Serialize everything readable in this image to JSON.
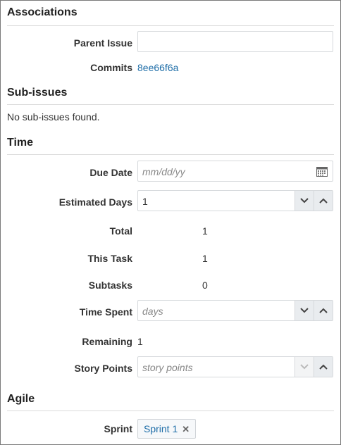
{
  "associations": {
    "title": "Associations",
    "parent_issue_label": "Parent Issue",
    "parent_issue_value": "",
    "commits_label": "Commits",
    "commits_value": "8ee66f6a"
  },
  "sub_issues": {
    "title": "Sub-issues",
    "empty_text": "No sub-issues found."
  },
  "time": {
    "title": "Time",
    "due_date_label": "Due Date",
    "due_date_placeholder": "mm/dd/yy",
    "estimated_days_label": "Estimated Days",
    "estimated_days_value": "1",
    "total_label": "Total",
    "total_value": "1",
    "this_task_label": "This Task",
    "this_task_value": "1",
    "subtasks_label": "Subtasks",
    "subtasks_value": "0",
    "time_spent_label": "Time Spent",
    "time_spent_placeholder": "days",
    "remaining_label": "Remaining",
    "remaining_value": "1",
    "story_points_label": "Story Points",
    "story_points_placeholder": "story points"
  },
  "agile": {
    "title": "Agile",
    "sprint_label": "Sprint",
    "sprint_value": "Sprint 1",
    "sprint_remove_glyph": "✕"
  },
  "icons": {
    "calendar": "calendar-icon",
    "chevron_down": "chevron-down-icon",
    "chevron_up": "chevron-up-icon",
    "remove": "close-icon"
  },
  "colors": {
    "link": "#1f6ea8",
    "spinner_bg": "#e9ecef",
    "border": "#d6d9dc"
  }
}
